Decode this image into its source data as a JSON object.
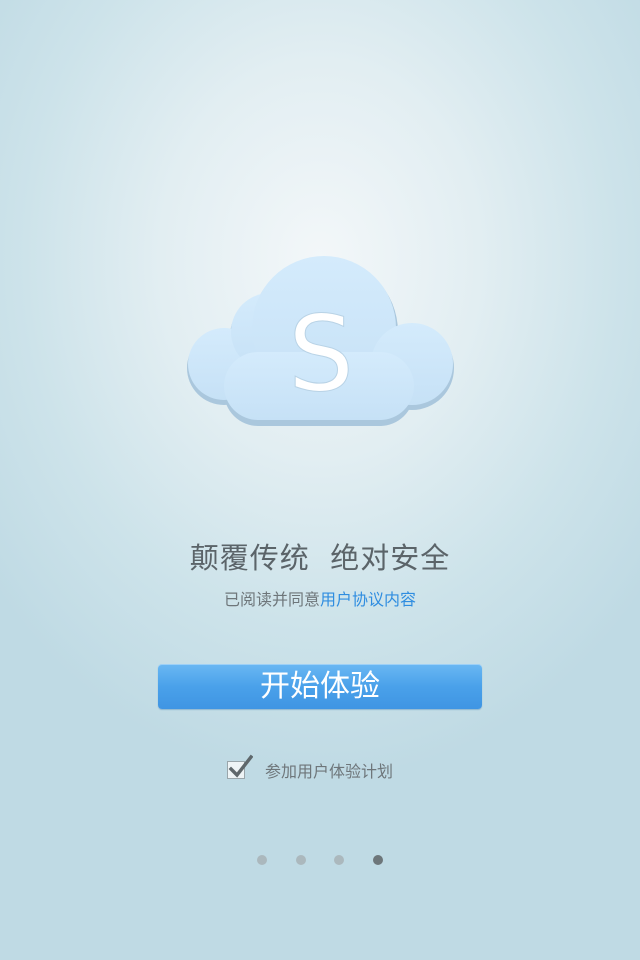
{
  "logo": {
    "icon": "cloud-icon",
    "letter": "S",
    "cloud_color": "#cde6fa",
    "shadow_color": "#a9c7de"
  },
  "slogan": "颠覆传统  绝对安全",
  "agreement": {
    "prefix": "已阅读并同意",
    "link_label": "用户协议内容",
    "link_color": "#2f8de0"
  },
  "start_button": {
    "label": "开始体验",
    "color": "#4aa1ea"
  },
  "user_experience_plan": {
    "label": "参加用户体验计划",
    "checked": true
  },
  "pager": {
    "total_pages": 4,
    "current_page": 4
  }
}
